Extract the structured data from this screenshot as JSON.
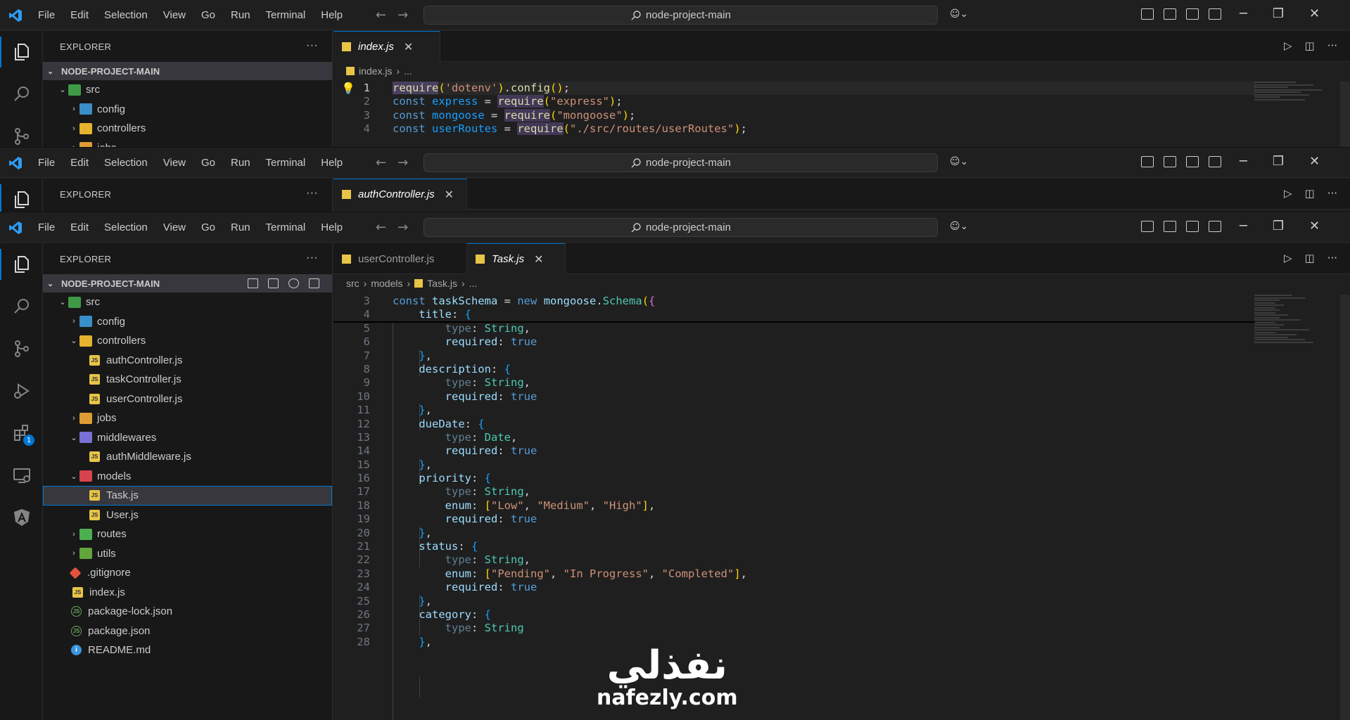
{
  "menu": [
    "File",
    "Edit",
    "Selection",
    "View",
    "Go",
    "Run",
    "Terminal",
    "Help"
  ],
  "command_center": "node-project-main",
  "window1": {
    "explorer_title": "EXPLORER",
    "project": "NODE-PROJECT-MAIN",
    "tree": [
      "src",
      "config",
      "controllers",
      "jobs"
    ],
    "tab": "index.js",
    "breadcrumb": [
      "index.js",
      "..."
    ],
    "lines": [
      {
        "n": "1"
      },
      {
        "n": "2"
      },
      {
        "n": "3"
      },
      {
        "n": "4"
      }
    ]
  },
  "window2": {
    "explorer_title": "EXPLORER",
    "tab": "authController.js"
  },
  "window3": {
    "explorer_title": "EXPLORER",
    "project": "NODE-PROJECT-MAIN",
    "tree": [
      "src",
      "config",
      "controllers",
      "authController.js",
      "taskController.js",
      "userController.js",
      "jobs",
      "middlewares",
      "authMiddleware.js",
      "models",
      "Task.js",
      "User.js",
      "routes",
      "utils",
      ".gitignore",
      "index.js",
      "package-lock.json",
      "package.json",
      "README.md"
    ],
    "tabs": [
      "userController.js",
      "Task.js"
    ],
    "breadcrumb": [
      "src",
      "models",
      "Task.js",
      "..."
    ],
    "extensions_badge": "1",
    "line_numbers": [
      "3",
      "4",
      "5",
      "6",
      "7",
      "8",
      "9",
      "10",
      "11",
      "12",
      "13",
      "14",
      "15",
      "16",
      "17",
      "18",
      "19",
      "20",
      "21",
      "22",
      "23",
      "24",
      "25",
      "26",
      "27",
      "28"
    ]
  },
  "watermark": {
    "arabic": "نفذلي",
    "latin": "nafezly.com"
  }
}
